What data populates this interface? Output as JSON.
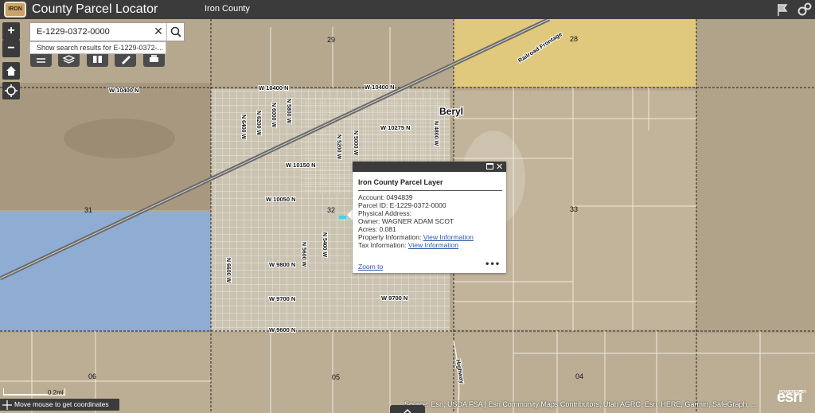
{
  "header": {
    "title": "County Parcel Locator",
    "subtitle": "Iron County",
    "logo_text": "IRON"
  },
  "search": {
    "value": "E-1229-0372-0000",
    "suggestion": "Show search results for E-1229-0372-..."
  },
  "map": {
    "sections": [
      "29",
      "28",
      "31",
      "32",
      "33",
      "06",
      "05",
      "04"
    ],
    "roads": [
      "W 10400 N",
      "W 10400 N",
      "W 10400 N",
      "W 10275 N",
      "W 10150 N",
      "W 10050 N",
      "W 9800 N",
      "W 9700 N",
      "W 9700 N",
      "W 9600 N",
      "Railroad Frontage",
      "Highway"
    ],
    "streets_vertical": [
      "N 6600 W",
      "N 6400 W",
      "N 6200 W",
      "N 6000 W",
      "N 5800 W",
      "N 5600 W",
      "N 5400 W",
      "N 5200 W",
      "N 5000 W",
      "N 4800 W"
    ],
    "place": "Beryl"
  },
  "popup": {
    "title": "Iron County Parcel Layer",
    "account": "Account: 0494839",
    "parcel_id": "Parcel ID: E-1229-0372-0000",
    "physical_address": "Physical Address:",
    "owner": "Owner: WAGNER ADAM SCOT",
    "acres": "Acres: 0.081",
    "property_info_label": "Property Information:",
    "property_info_link": "View Information",
    "tax_info_label": "Tax Information:",
    "tax_info_link": "View Information",
    "zoom_to": "Zoom to",
    "more": "•••"
  },
  "footer": {
    "coordinates_text": "Move mouse to get coordinates",
    "scale_label": "0.2mi",
    "attribution": "Source: Esri, USDA FSA | Esri Community Maps Contributors, Utah AGRC, Esri, HERE, Garmin, SafeGraph, ...",
    "powered_by": "POWERED BY",
    "esri": "esri"
  },
  "colors": {
    "header_bg": "#3b3b3b",
    "selected_section_yellow": "#e8cf79",
    "selected_section_blue": "#86aee3",
    "highlight_parcel": "#3fd3f0"
  }
}
